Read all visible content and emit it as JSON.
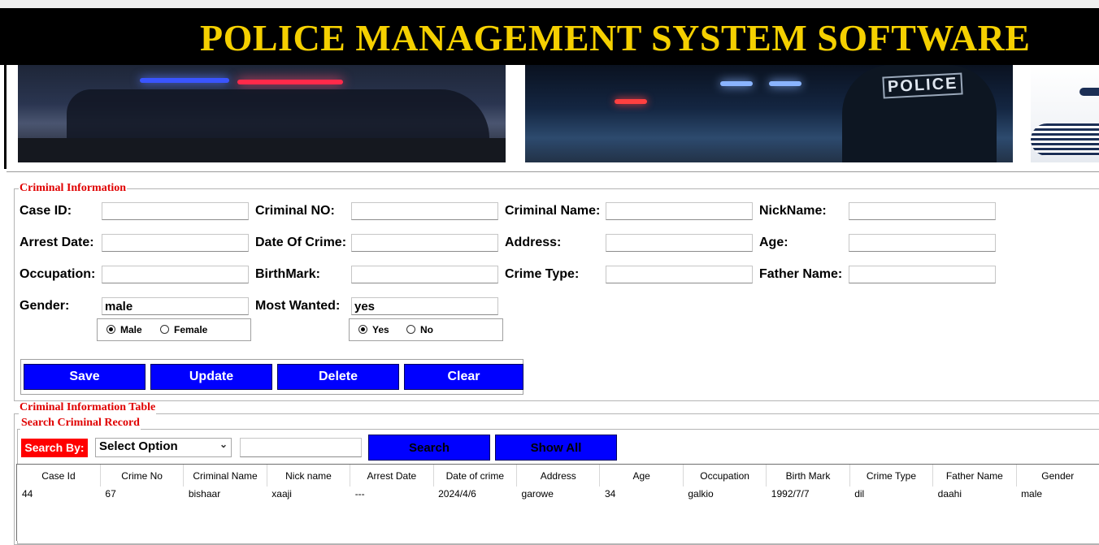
{
  "banner": {
    "title": "POLICE MANAGEMENT SYSTEM SOFTWARE",
    "title_color": "#f5d000",
    "background": "#000000"
  },
  "images": {
    "police_badge_text": "POLICE"
  },
  "criminal_info": {
    "group_title": "Criminal Information",
    "fields": {
      "case_id": {
        "label": "Case ID:",
        "value": ""
      },
      "criminal_no": {
        "label": "Criminal NO:",
        "value": ""
      },
      "criminal_name": {
        "label": "Criminal Name:",
        "value": ""
      },
      "nickname": {
        "label": "NickName:",
        "value": ""
      },
      "arrest_date": {
        "label": "Arrest Date:",
        "value": ""
      },
      "date_of_crime": {
        "label": "Date Of Crime:",
        "value": ""
      },
      "address": {
        "label": "Address:",
        "value": ""
      },
      "age": {
        "label": "Age:",
        "value": ""
      },
      "occupation": {
        "label": "Occupation:",
        "value": ""
      },
      "birthmark": {
        "label": "BirthMark:",
        "value": ""
      },
      "crime_type": {
        "label": "Crime Type:",
        "value": ""
      },
      "father_name": {
        "label": "Father Name:",
        "value": ""
      },
      "gender": {
        "label": "Gender:",
        "value": "male"
      },
      "most_wanted": {
        "label": "Most Wanted:",
        "value": "yes"
      }
    },
    "gender_options": {
      "male": "Male",
      "female": "Female",
      "selected": "male"
    },
    "wanted_options": {
      "yes": "Yes",
      "no": "No",
      "selected": "yes"
    },
    "buttons": {
      "save": "Save",
      "update": "Update",
      "delete": "Delete",
      "clear": "Clear"
    }
  },
  "table_group": {
    "title": "Criminal Information Table"
  },
  "search": {
    "group_title": "Search Criminal Record",
    "label": "Search By:",
    "select_value": "Select Option",
    "input_value": "",
    "search_button": "Search",
    "show_all_button": "Show All"
  },
  "table": {
    "columns": [
      "Case Id",
      "Crime No",
      "Criminal Name",
      "Nick name",
      "Arrest Date",
      "Date of crime",
      "Address",
      "Age",
      "Occupation",
      "Birth Mark",
      "Crime Type",
      "Father Name",
      "Gender"
    ],
    "rows": [
      [
        "44",
        "67",
        "bishaar",
        "xaaji",
        "---",
        "2024/4/6",
        "garowe",
        "34",
        "galkio",
        "1992/7/7",
        "dil",
        "daahi",
        "male"
      ]
    ]
  },
  "colors": {
    "accent_blue": "#0000ff",
    "label_red": "#e00000",
    "search_label_bg": "#ff0000"
  }
}
